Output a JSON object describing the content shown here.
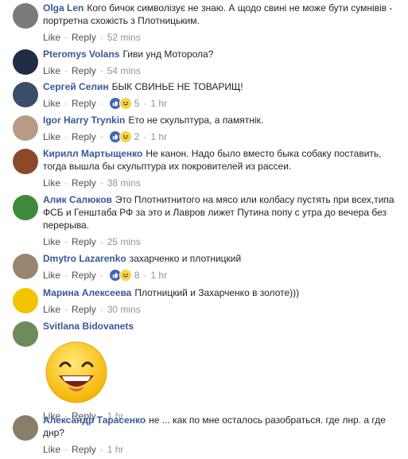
{
  "actions": {
    "like": "Like",
    "reply": "Reply",
    "sep": "·"
  },
  "comments": [
    {
      "author": "Olga Len",
      "text": "Кого бичок символізує не знаю. А щодо свині не може бути сумнівів - портретна схожість з Плотницьким.",
      "time": "52 mins",
      "reactions": null,
      "avatar_color": "#7a7a7a"
    },
    {
      "author": "Pteromys Volans",
      "text": "Гиви унд Моторола?",
      "time": "54 mins",
      "reactions": null,
      "avatar_color": "#1f2d45"
    },
    {
      "author": "Сергей Селин",
      "text": "БЫК СВИНЬЕ НЕ ТОВАРИЩ!",
      "time": "1 hr",
      "reactions": "5",
      "avatar_color": "#3a4d6b"
    },
    {
      "author": "Igor Harry Trynkin",
      "text": "Ето не скульптура, а памятнік.",
      "time": "1 hr",
      "reactions": "2",
      "avatar_color": "#b89a86"
    },
    {
      "author": "Кирилл Мартыщенко",
      "text": "Не канон. Надо было вместо быка собаку поставить, тогда вышла бы скульптура их покровителей из рассеи.",
      "time": "38 mins",
      "reactions": null,
      "avatar_color": "#8a4a2a"
    },
    {
      "author": "Алик Салюков",
      "text": "Это Плотнитнитого на мясо или колбасу пустять при всех,типа ФСБ и Генштаба РФ за это и Лавров лижет Путина попу с утра до вечера без перерыва.",
      "time": "25 mins",
      "reactions": null,
      "avatar_color": "#3f8a3a"
    },
    {
      "author": "Dmytro Lazarenko",
      "text": "захарченко и плотницкий",
      "time": "1 hr",
      "reactions": "8",
      "avatar_color": "#9a8670"
    },
    {
      "author": "Марина Алексеева",
      "text": "Плотницкий и Захарченко в золоте)))",
      "time": "30 mins",
      "reactions": null,
      "avatar_color": "#f2c400"
    },
    {
      "author": "Svitlana Bidovanets",
      "text": "",
      "time": "1 hr",
      "reactions": null,
      "avatar_color": "#6f8b5a",
      "sticker": "laughing-face"
    },
    {
      "author": "Александр Тарасенко",
      "text": "не ... как по мне осталось разобраться. где лнр. а где днр?",
      "time": "1 hr",
      "reactions": null,
      "avatar_color": "#8a7e6a"
    }
  ]
}
